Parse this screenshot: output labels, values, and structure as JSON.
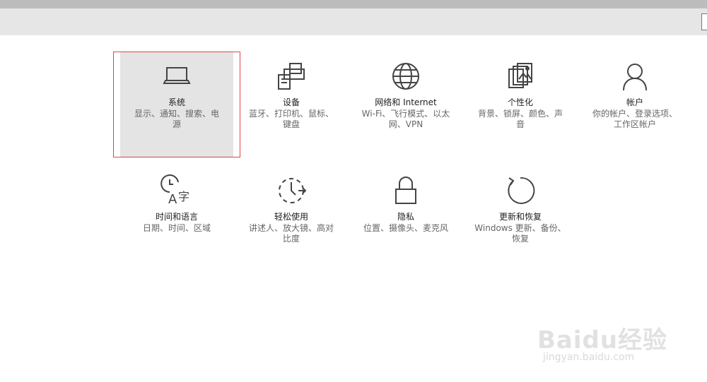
{
  "settings": {
    "tiles": [
      {
        "title": "系统",
        "desc": "显示、通知、搜索、电源",
        "icon": "laptop-icon"
      },
      {
        "title": "设备",
        "desc": "蓝牙、打印机、鼠标、键盘",
        "icon": "printer-icon"
      },
      {
        "title": "网络和 Internet",
        "desc": "Wi-Fi、飞行模式、以太网、VPN",
        "icon": "globe-icon"
      },
      {
        "title": "个性化",
        "desc": "背景、锁屏、颜色、声音",
        "icon": "personalization-icon"
      },
      {
        "title": "帐户",
        "desc": "你的帐户、登录选项、工作区帐户",
        "icon": "person-icon"
      },
      {
        "title": "时间和语言",
        "desc": "日期、时间、区域",
        "icon": "time-language-icon"
      },
      {
        "title": "轻松使用",
        "desc": "讲述人、放大镜、高对比度",
        "icon": "ease-of-access-icon"
      },
      {
        "title": "隐私",
        "desc": "位置、摄像头、麦克风",
        "icon": "lock-icon"
      },
      {
        "title": "更新和恢复",
        "desc": "Windows 更新、备份、恢复",
        "icon": "refresh-icon"
      }
    ]
  },
  "watermark": {
    "logo": "Baidu经验",
    "sub": "jingyan.baidu.com"
  },
  "colors": {
    "selection_bg": "#e4e4e4",
    "selection_outline": "#e04545",
    "icon": "#444444"
  }
}
